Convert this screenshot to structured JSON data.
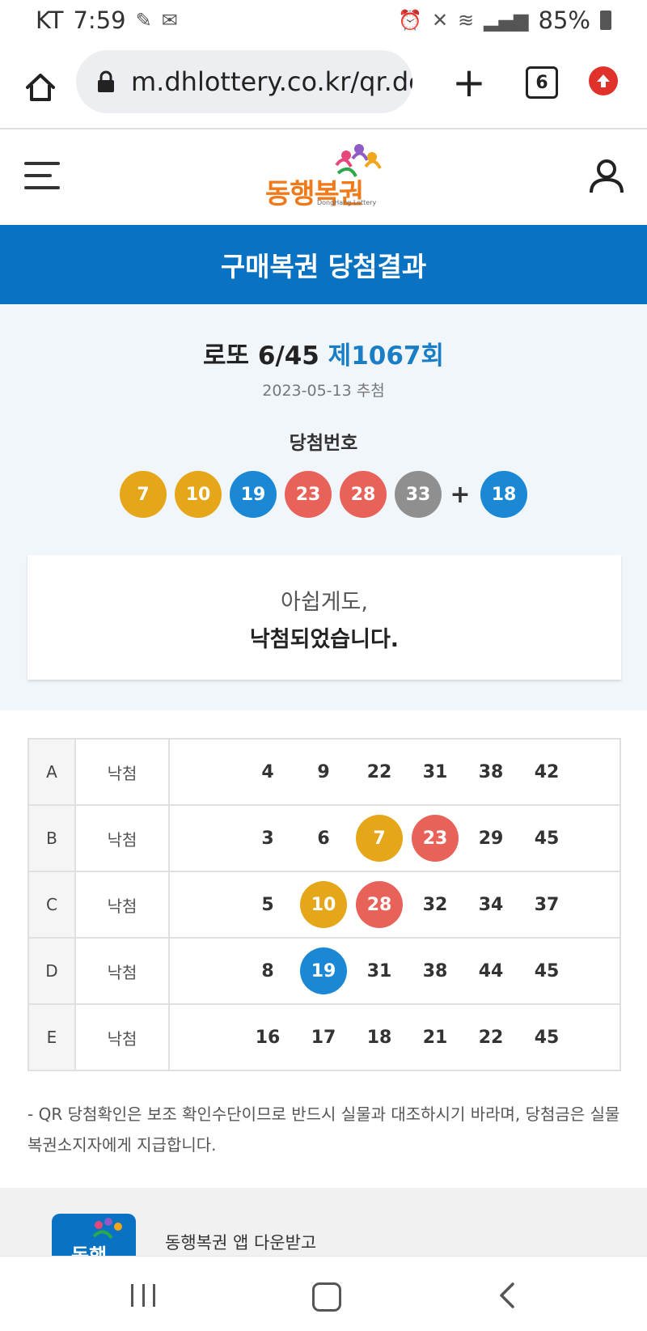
{
  "status_bar": {
    "carrier": "KT",
    "time": "7:59",
    "battery": "85%"
  },
  "browser": {
    "url": "m.dhlottery.co.kr/qr.do",
    "tab_count": "6"
  },
  "site": {
    "logo_text": "동행복권",
    "logo_sub": "DongHang Lottery"
  },
  "page_title": "구매복권 당첨결과",
  "draw": {
    "game": "로또 6/45",
    "round": "제1067회",
    "date": "2023-05-13 추첨",
    "winning_label": "당첨번호",
    "numbers": [
      "7",
      "10",
      "19",
      "23",
      "28",
      "33"
    ],
    "plus": "+",
    "bonus": "18"
  },
  "result": {
    "line1": "아쉽게도,",
    "line2": "낙첨되었습니다."
  },
  "tickets": [
    {
      "letter": "A",
      "status": "낙첨",
      "numbers": [
        "4",
        "9",
        "22",
        "31",
        "38",
        "42"
      ]
    },
    {
      "letter": "B",
      "status": "낙첨",
      "numbers": [
        "3",
        "6",
        "7",
        "23",
        "29",
        "45"
      ]
    },
    {
      "letter": "C",
      "status": "낙첨",
      "numbers": [
        "5",
        "10",
        "28",
        "32",
        "34",
        "37"
      ]
    },
    {
      "letter": "D",
      "status": "낙첨",
      "numbers": [
        "8",
        "19",
        "31",
        "38",
        "44",
        "45"
      ]
    },
    {
      "letter": "E",
      "status": "낙첨",
      "numbers": [
        "16",
        "17",
        "18",
        "21",
        "22",
        "45"
      ]
    }
  ],
  "notice": "- QR 당첨확인은 보조 확인수단이므로 반드시 실물과 대조하시기 바라며, 당첨금은 실물 복권소지자에게 지급합니다.",
  "app_banner": {
    "icon_text": "동행",
    "text": "동행복권 앱 다운받고"
  },
  "colors": {
    "ball_yellow": "#e5a61a",
    "ball_blue": "#1a88d4",
    "ball_red": "#e8625a",
    "ball_gray": "#8f8f8f",
    "brand_blue": "#0a72c2"
  }
}
